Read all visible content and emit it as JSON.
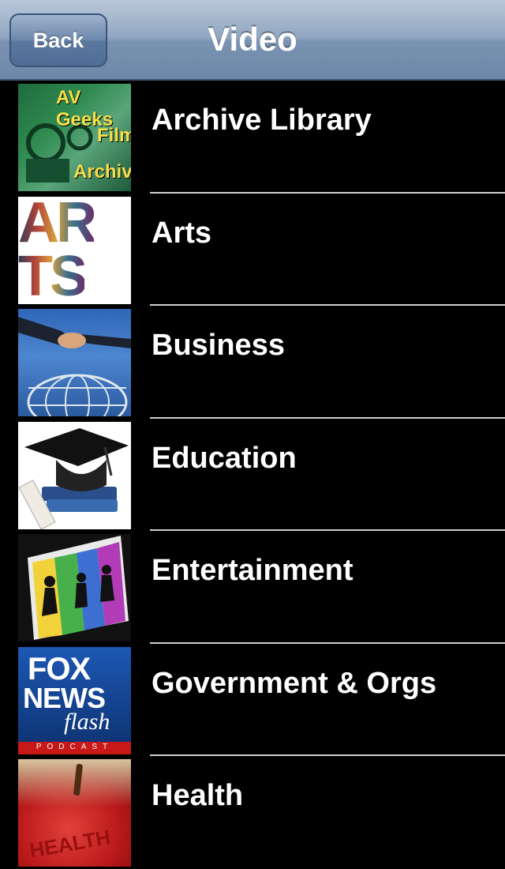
{
  "nav": {
    "back_label": "Back",
    "title": "Video"
  },
  "items": [
    {
      "label": "Archive Library",
      "thumb_text": [
        "AV Geeks",
        "Film",
        "Archive"
      ]
    },
    {
      "label": "Arts",
      "thumb_text": [
        "AR",
        "TS"
      ]
    },
    {
      "label": "Business"
    },
    {
      "label": "Education"
    },
    {
      "label": "Entertainment"
    },
    {
      "label": "Government & Orgs",
      "thumb_text": [
        "FOX",
        "NEWS",
        "flash",
        "PODCAST"
      ]
    },
    {
      "label": "Health",
      "thumb_text": [
        "HEALTH"
      ]
    }
  ]
}
